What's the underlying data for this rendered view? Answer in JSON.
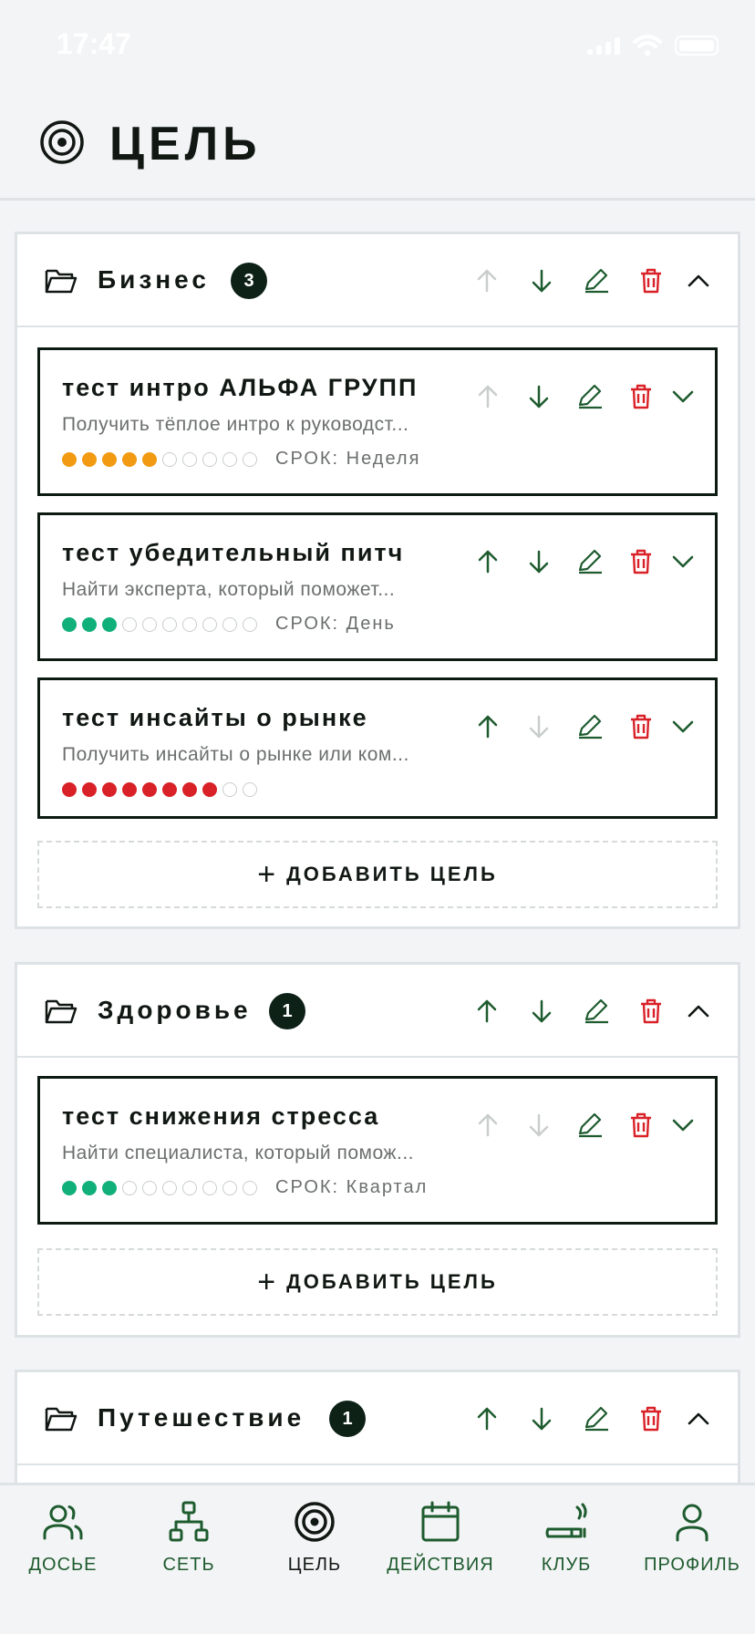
{
  "status_bar": {
    "time": "17:47"
  },
  "header": {
    "title": "ЦЕЛЬ",
    "icon": "target-icon"
  },
  "groups": [
    {
      "name": "Бизнес",
      "count": "3",
      "goals": [
        {
          "title": "тест интро АЛЬФА ГРУПП",
          "description": "Получить тёплое интро к руководст...",
          "progress": 5,
          "progress_max": 10,
          "progress_color": "#f29a12",
          "deadline": "СРОК: Неделя"
        },
        {
          "title": "тест убедительный питч",
          "description": "Найти эксперта, который поможет...",
          "progress": 3,
          "progress_max": 10,
          "progress_color": "#11b07b",
          "deadline": "СРОК: День"
        },
        {
          "title": "тест инсайты о рынке",
          "description": "Получить инсайты о рынке или ком...",
          "progress": 8,
          "progress_max": 10,
          "progress_color": "#d92128",
          "deadline": ""
        }
      ],
      "add_label": "ДОБАВИТЬ ЦЕЛЬ"
    },
    {
      "name": "Здоровье",
      "count": "1",
      "goals": [
        {
          "title": "тест снижения стресса",
          "description": "Найти специалиста, который помож...",
          "progress": 3,
          "progress_max": 10,
          "progress_color": "#11b07b",
          "deadline": "СРОК: Квартал"
        }
      ],
      "add_label": "ДОБАВИТЬ ЦЕЛЬ"
    },
    {
      "name": "Путешествие",
      "count": "1",
      "goals": []
    }
  ],
  "nav": [
    {
      "label": "ДОСЬЕ",
      "icon": "users-icon"
    },
    {
      "label": "СЕТЬ",
      "icon": "network-icon"
    },
    {
      "label": "ЦЕЛЬ",
      "icon": "target-icon",
      "active": true
    },
    {
      "label": "ДЕЙСТВИЯ",
      "icon": "calendar-icon"
    },
    {
      "label": "КЛУБ",
      "icon": "cigar-icon"
    },
    {
      "label": "ПРОФИЛЬ",
      "icon": "user-icon"
    }
  ],
  "colors": {
    "action_green": "#1e5b2e",
    "delete_red": "#d92128",
    "disabled": "#c9cecd",
    "badge": "#0d2117"
  }
}
